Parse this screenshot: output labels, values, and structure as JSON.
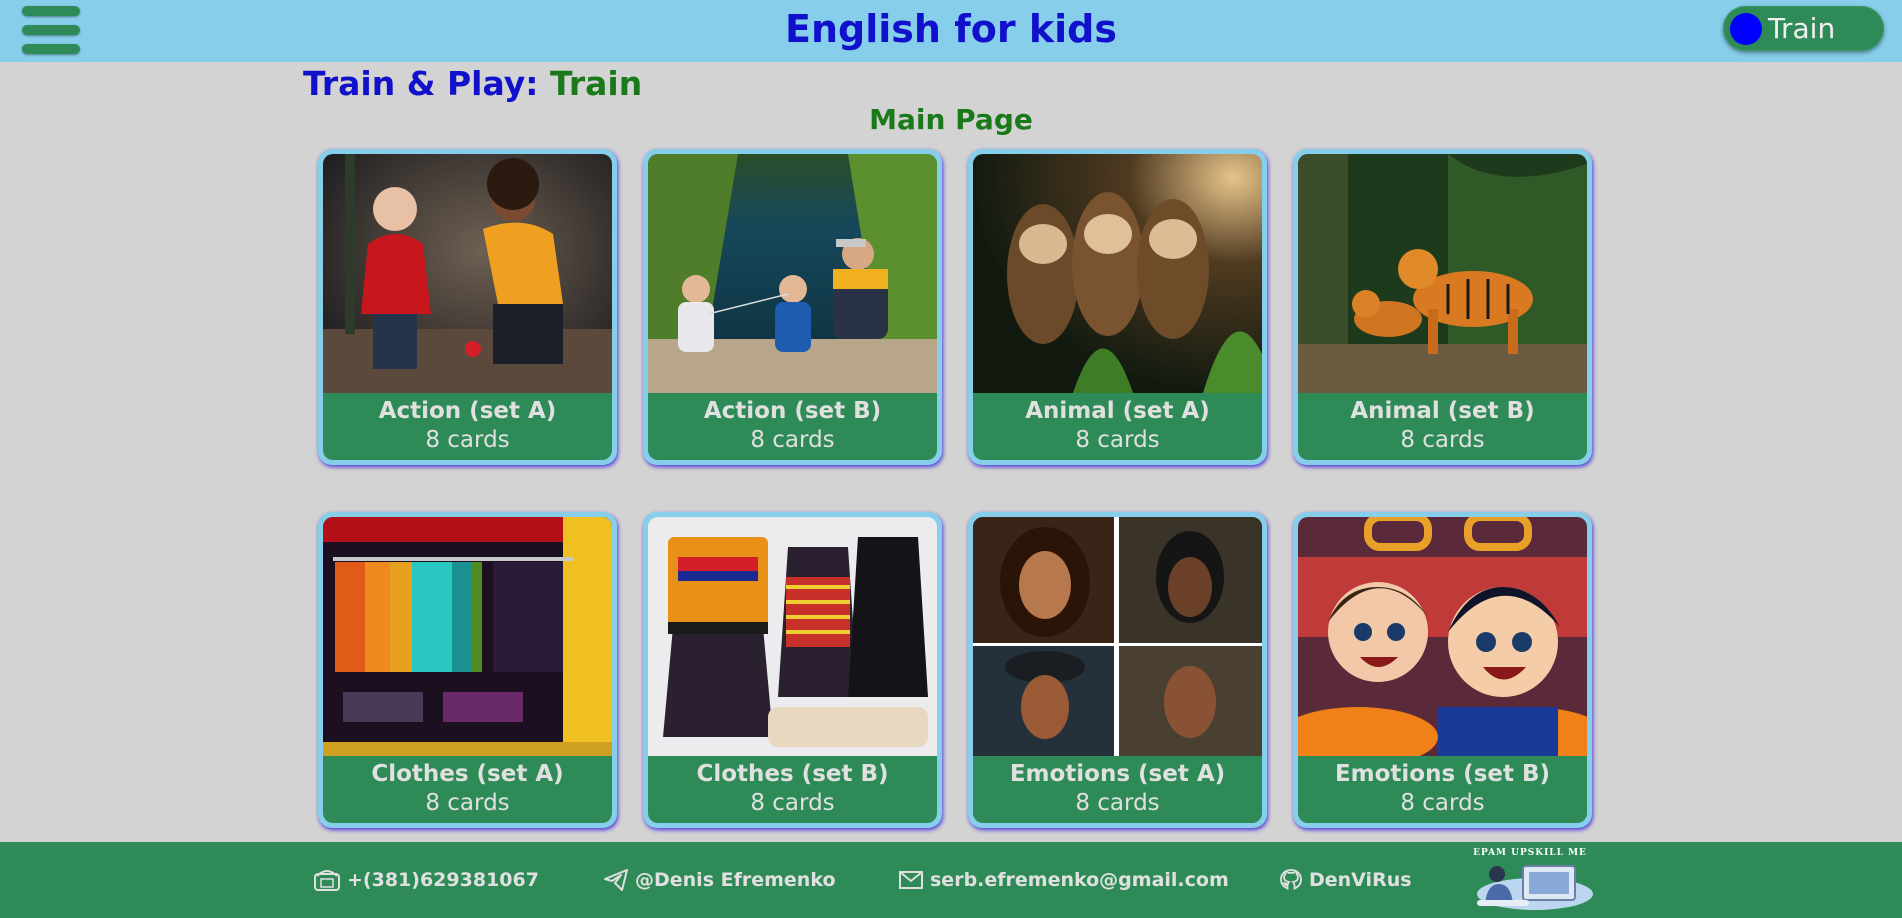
{
  "header": {
    "title": "English for kids",
    "toggle_label": "Train",
    "colors": {
      "bar": "#87ceeb",
      "toggle": "#2e8b57",
      "knob": "#0000ff"
    }
  },
  "mode_heading": {
    "label": "Train & Play:",
    "value": "Train"
  },
  "page_title": "Main Page",
  "cards": [
    {
      "title": "Action (set A)",
      "count": "8 cards",
      "image": "children-playing-ball"
    },
    {
      "title": "Action (set B)",
      "count": "8 cards",
      "image": "kids-fishing-at-pond"
    },
    {
      "title": "Animal (set A)",
      "count": "8 cards",
      "image": "sloths-in-forest"
    },
    {
      "title": "Animal (set B)",
      "count": "8 cards",
      "image": "tigers-in-jungle"
    },
    {
      "title": "Clothes (set A)",
      "count": "8 cards",
      "image": "clothes-rack"
    },
    {
      "title": "Clothes (set B)",
      "count": "8 cards",
      "image": "jackets-on-hangers"
    },
    {
      "title": "Emotions (set A)",
      "count": "8 cards",
      "image": "four-faces-grid"
    },
    {
      "title": "Emotions (set B)",
      "count": "8 cards",
      "image": "cartoon-kids-smiling"
    }
  ],
  "footer": {
    "phone": "+(381)629381067",
    "telegram": "@Denis Efremenko",
    "email": "serb.efremenko@gmail.com",
    "github": "DenViRus",
    "logo_text": "EPAM UPSKILL ME",
    "icons": [
      "phone-icon",
      "telegram-icon",
      "mail-icon",
      "github-icon"
    ]
  }
}
